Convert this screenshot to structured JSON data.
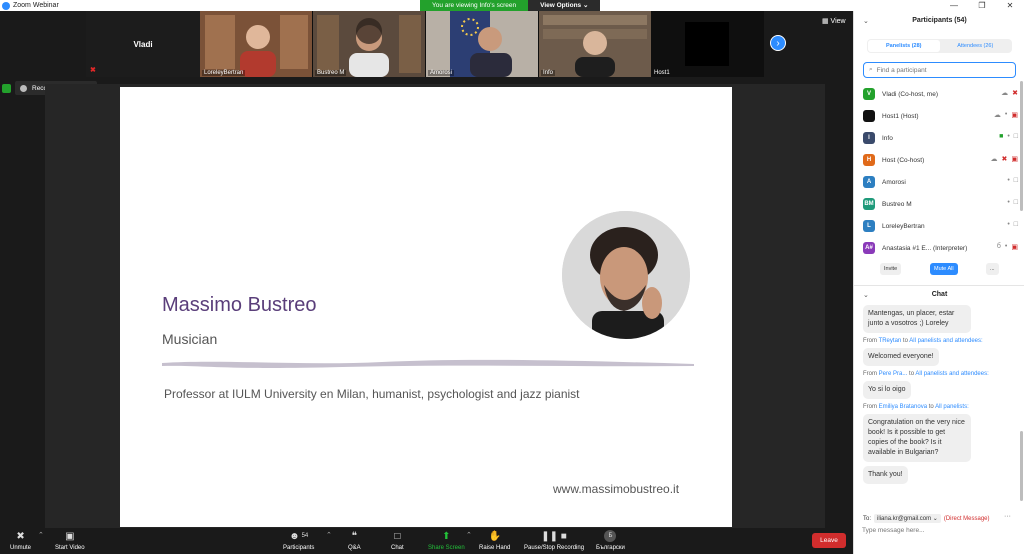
{
  "window": {
    "title": "Zoom Webinar",
    "controls": [
      "—",
      "❐",
      "✕"
    ]
  },
  "banner": {
    "viewing": "You are viewing Info's screen",
    "options": "View Options ⌄"
  },
  "video_strip": {
    "self_name": "Vladi",
    "tiles": [
      {
        "name": "LoreleyBertran",
        "colors": {
          "bg": "#8a5a3c",
          "accent": "#c58a62"
        }
      },
      {
        "name": "Bustreo M",
        "colors": {
          "bg": "#5b4a3d",
          "accent": "#c7b8a8"
        }
      },
      {
        "name": "Amorosi",
        "colors": {
          "bg": "#2c3e73",
          "accent": "#d8c9a8"
        }
      },
      {
        "name": "Info",
        "colors": {
          "bg": "#6d5b4b",
          "accent": "#d6cfc6"
        }
      }
    ],
    "host1_name": "Host1",
    "view_label": "▦ View"
  },
  "recording": {
    "label": "Recording...",
    "pause_icon": "pause-icon",
    "stop_icon": "stop-icon"
  },
  "slide": {
    "speaker_name": "Massimo Bustreo",
    "speaker_role": "Musician",
    "speaker_bio": "Professor at IULM University en Milan, humanist, psychologist and jazz pianist",
    "speaker_site": "www.massimobustreo.it"
  },
  "toolbar": {
    "unmute": "Unmute",
    "start_video": "Start Video",
    "participants": "Participants",
    "participants_count": "54",
    "qa": "Q&A",
    "chat": "Chat",
    "share_screen": "Share Screen",
    "raise_hand": "Raise Hand",
    "pause_stop_recording": "Pause/Stop Recording",
    "language": "Български",
    "leave": "Leave"
  },
  "participants_panel": {
    "title": "Participants (54)",
    "tab_panelists": "Panelists (28)",
    "tab_attendees": "Attendees (26)",
    "search_placeholder": "Find a participant",
    "people": [
      {
        "initials": "V",
        "name": "Vladi (Co-host, me)",
        "color": "#23a12c"
      },
      {
        "initials": "",
        "name": "Host1 (Host)",
        "color": "#111111"
      },
      {
        "initials": "I",
        "name": "Info",
        "color": "#3a4a6b"
      },
      {
        "initials": "H",
        "name": "Host (Co-host)",
        "color": "#e06a1a"
      },
      {
        "initials": "A",
        "name": "Amorosi",
        "color": "#2d7fc1"
      },
      {
        "initials": "BM",
        "name": "Bustreo M",
        "color": "#1f9a7a"
      },
      {
        "initials": "L",
        "name": "LoreleyBertran",
        "color": "#2d7fc1"
      },
      {
        "initials": "A#",
        "name": "Anastasia #1 E... (Interpreter)",
        "color": "#8a3ab9"
      }
    ],
    "invite": "Invite",
    "mute_all": "Mute All",
    "more": "..."
  },
  "chat_panel": {
    "title": "Chat",
    "messages": [
      {
        "meta_from": "",
        "meta_to": "",
        "text": "Mantengas, un placer, estar junto a vosotros ;) Loreley"
      },
      {
        "meta_from": "TReytan",
        "meta_to": "All panelists and attendees:",
        "text": "Welcomed everyone!"
      },
      {
        "meta_from": "Pere Pra...",
        "meta_to": "All panelists and attendees:",
        "text": "Yo si lo oigo"
      },
      {
        "meta_from": "Emiliya Bratanova",
        "meta_to": "All panelists:",
        "text": "Congratulation on the very nice book! Is it possible to get copies of the book? Is it available in Bulgarian?"
      },
      {
        "meta_from": "",
        "meta_to": "",
        "text": "Thank you!"
      }
    ],
    "from_word": "From",
    "to_word": "to",
    "to_label": "To:",
    "recipient": "iliana.kr@gmail.com ⌄",
    "direct": "(Direct Message)",
    "more": "···",
    "input_placeholder": "Type message here..."
  }
}
